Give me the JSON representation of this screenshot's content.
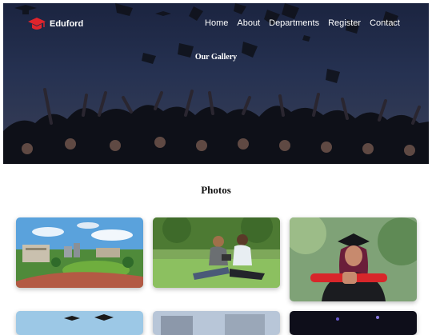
{
  "brand": {
    "name": "Eduford"
  },
  "nav": {
    "items": [
      "Home",
      "About",
      "Departments",
      "Register",
      "Contact"
    ]
  },
  "hero": {
    "title": "Our Gallery"
  },
  "gallery": {
    "title": "Photos",
    "photos": [
      {
        "alt": "campus-photo"
      },
      {
        "alt": "students-studying-photo"
      },
      {
        "alt": "graduate-with-diploma-photo"
      },
      {
        "alt": "graduation-caps-photo"
      },
      {
        "alt": "campus-building-photo"
      },
      {
        "alt": "event-photo"
      }
    ]
  }
}
